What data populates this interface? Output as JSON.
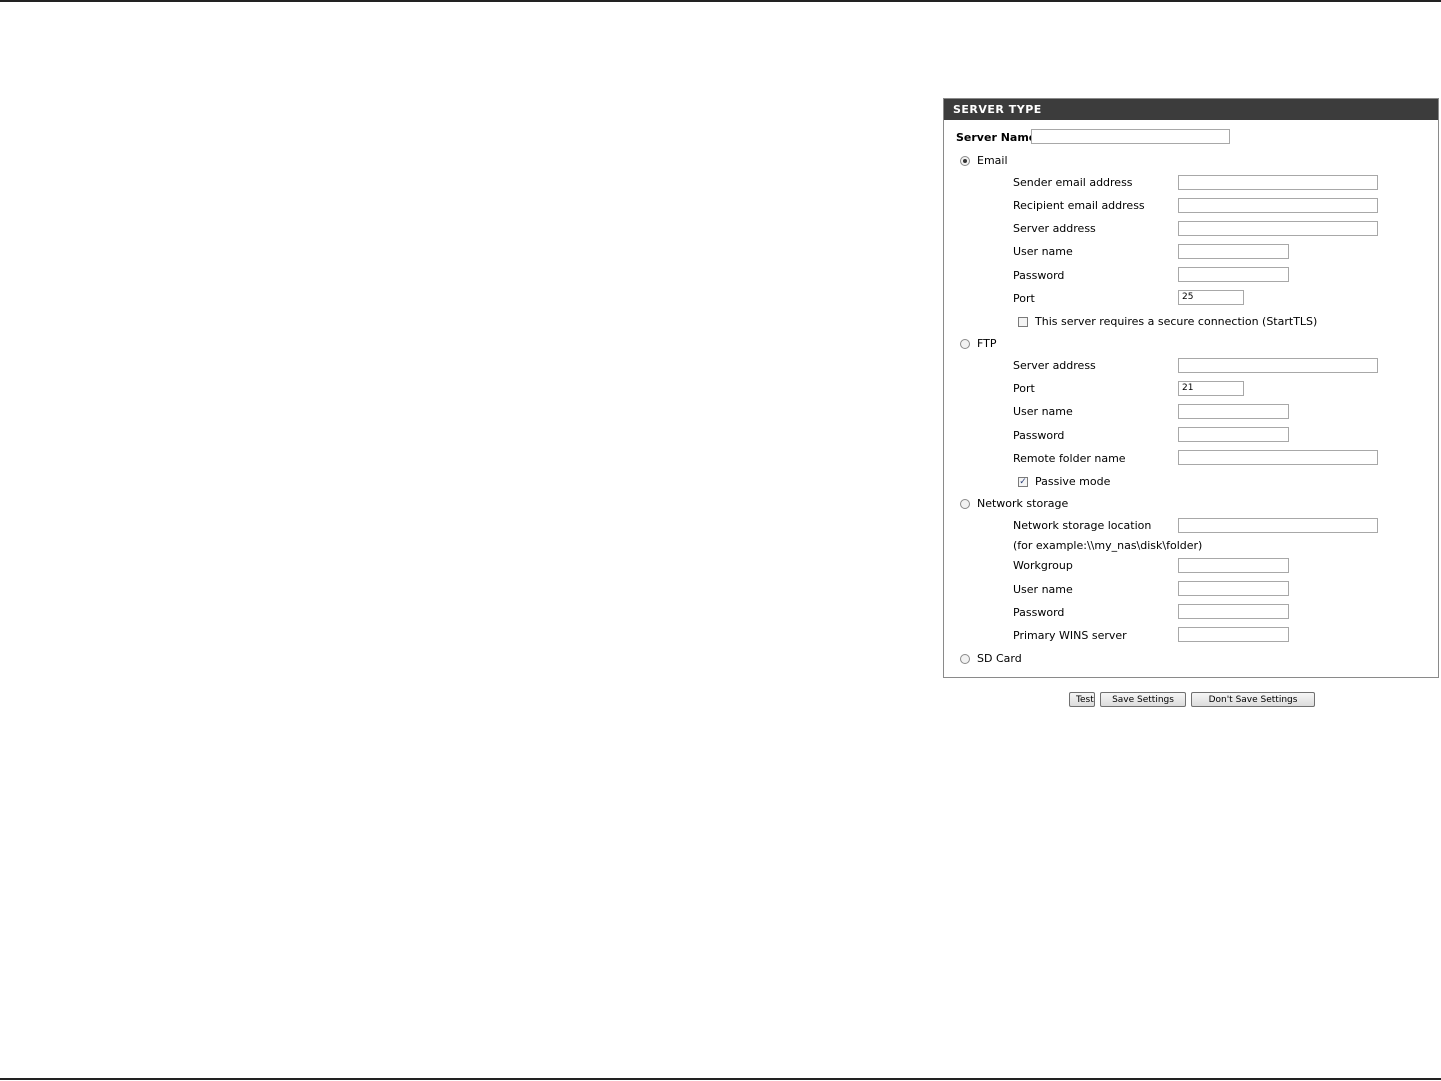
{
  "panel": {
    "title": "SERVER TYPE",
    "server_name_label": "Server Name:",
    "server_name_value": ""
  },
  "email": {
    "label": "Email",
    "selected": true,
    "sender_label": "Sender email address",
    "recipient_label": "Recipient email address",
    "server_label": "Server address",
    "user_label": "User name",
    "password_label": "Password",
    "port_label": "Port",
    "port_value": "25",
    "secure_label": "This server requires a secure connection (StartTLS)",
    "secure_checked": false
  },
  "ftp": {
    "label": "FTP",
    "selected": false,
    "server_label": "Server address",
    "port_label": "Port",
    "port_value": "21",
    "user_label": "User name",
    "password_label": "Password",
    "folder_label": "Remote folder name",
    "passive_label": "Passive mode",
    "passive_checked": true,
    "passive_mark": "✓"
  },
  "network_storage": {
    "label": "Network storage",
    "selected": false,
    "location_label": "Network storage location",
    "example_text": "(for example:\\\\my_nas\\disk\\folder)",
    "workgroup_label": "Workgroup",
    "user_label": "User name",
    "password_label": "Password",
    "wins_label": "Primary WINS server"
  },
  "sd_card": {
    "label": "SD Card",
    "selected": false
  },
  "buttons": {
    "test": "Test",
    "save": "Save Settings",
    "dont_save": "Don't Save Settings"
  }
}
